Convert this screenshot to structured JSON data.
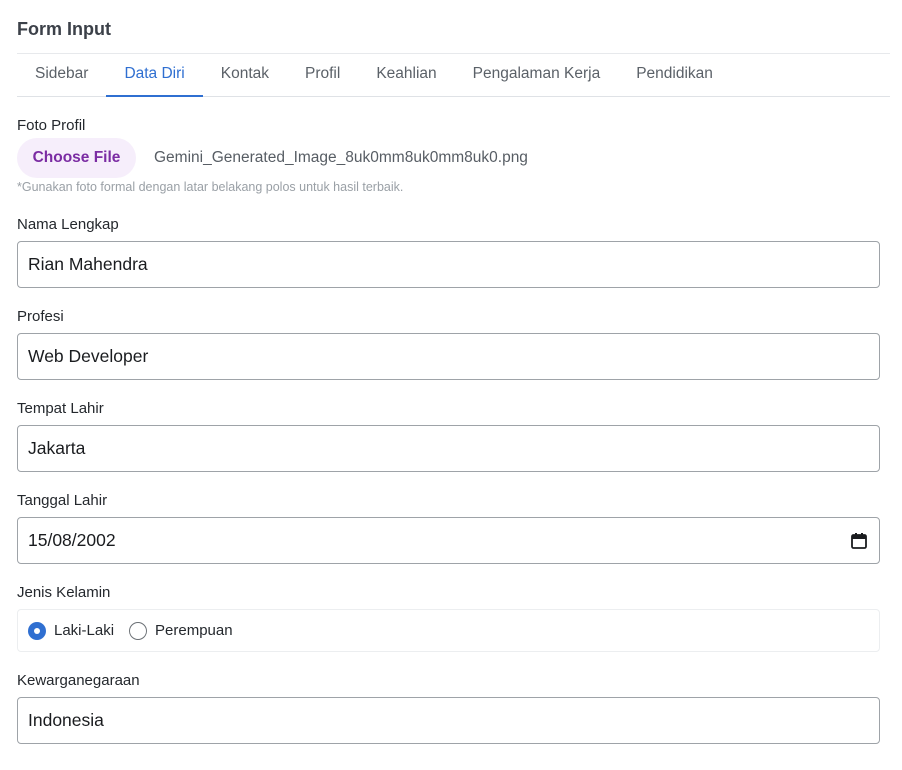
{
  "page": {
    "title": "Form Input"
  },
  "tabs": [
    {
      "label": "Sidebar",
      "active": false
    },
    {
      "label": "Data Diri",
      "active": true
    },
    {
      "label": "Kontak",
      "active": false
    },
    {
      "label": "Profil",
      "active": false
    },
    {
      "label": "Keahlian",
      "active": false
    },
    {
      "label": "Pengalaman Kerja",
      "active": false
    },
    {
      "label": "Pendidikan",
      "active": false
    }
  ],
  "photo": {
    "label": "Foto Profil",
    "button_label": "Choose File",
    "file_name": "Gemini_Generated_Image_8uk0mm8uk0mm8uk0.png",
    "hint": "*Gunakan foto formal dengan latar belakang polos untuk hasil terbaik."
  },
  "fields": {
    "nama": {
      "label": "Nama Lengkap",
      "value": "Rian Mahendra"
    },
    "profesi": {
      "label": "Profesi",
      "value": "Web Developer"
    },
    "tempat_lahir": {
      "label": "Tempat Lahir",
      "value": "Jakarta"
    },
    "tanggal_lahir": {
      "label": "Tanggal Lahir",
      "value": "15/08/2002",
      "icon": "calendar-icon"
    },
    "kewarganegaraan": {
      "label": "Kewarganegaraan",
      "value": "Indonesia"
    }
  },
  "gender": {
    "label": "Jenis Kelamin",
    "options": [
      {
        "label": "Laki-Laki",
        "checked": true
      },
      {
        "label": "Perempuan",
        "checked": false
      }
    ]
  },
  "colors": {
    "accent": "#2f6fd1",
    "file_button_bg": "#f6eefb",
    "file_button_text": "#7b2ca3"
  }
}
